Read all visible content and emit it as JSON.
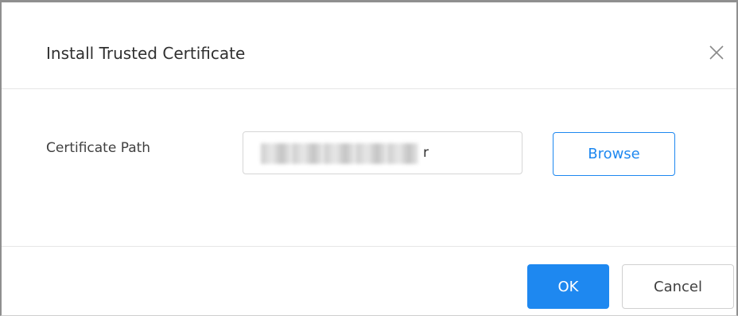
{
  "dialog": {
    "title": "Install Trusted Certificate",
    "close_icon": "close-icon"
  },
  "form": {
    "path_label": "Certificate Path",
    "path_value": "r",
    "browse_label": "Browse"
  },
  "footer": {
    "ok_label": "OK",
    "cancel_label": "Cancel"
  },
  "colors": {
    "accent": "#1e88f0",
    "border": "#d6d6d6",
    "divider": "#e6e6e6"
  }
}
